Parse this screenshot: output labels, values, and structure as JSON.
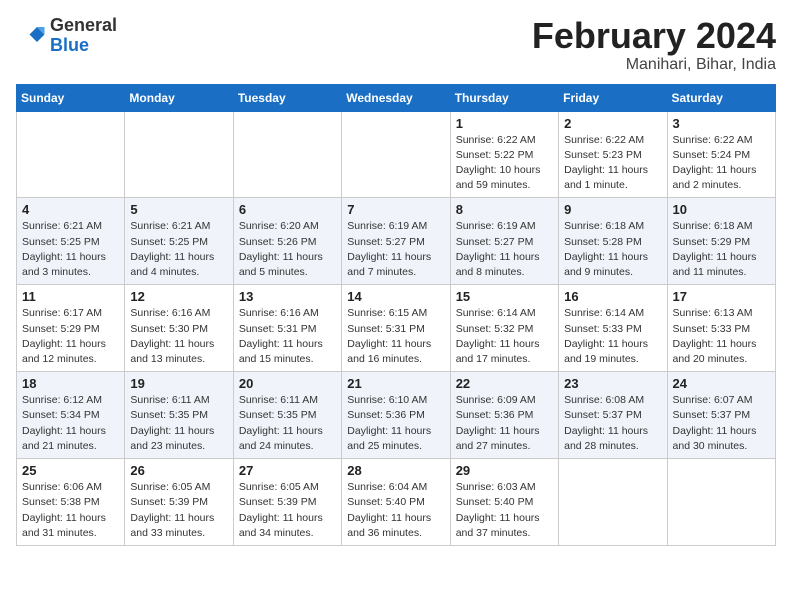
{
  "header": {
    "logo_general": "General",
    "logo_blue": "Blue",
    "month_title": "February 2024",
    "location": "Manihari, Bihar, India"
  },
  "weekdays": [
    "Sunday",
    "Monday",
    "Tuesday",
    "Wednesday",
    "Thursday",
    "Friday",
    "Saturday"
  ],
  "weeks": [
    [
      {
        "day": "",
        "info": ""
      },
      {
        "day": "",
        "info": ""
      },
      {
        "day": "",
        "info": ""
      },
      {
        "day": "",
        "info": ""
      },
      {
        "day": "1",
        "sunrise": "Sunrise: 6:22 AM",
        "sunset": "Sunset: 5:22 PM",
        "daylight": "Daylight: 10 hours and 59 minutes."
      },
      {
        "day": "2",
        "sunrise": "Sunrise: 6:22 AM",
        "sunset": "Sunset: 5:23 PM",
        "daylight": "Daylight: 11 hours and 1 minute."
      },
      {
        "day": "3",
        "sunrise": "Sunrise: 6:22 AM",
        "sunset": "Sunset: 5:24 PM",
        "daylight": "Daylight: 11 hours and 2 minutes."
      }
    ],
    [
      {
        "day": "4",
        "sunrise": "Sunrise: 6:21 AM",
        "sunset": "Sunset: 5:25 PM",
        "daylight": "Daylight: 11 hours and 3 minutes."
      },
      {
        "day": "5",
        "sunrise": "Sunrise: 6:21 AM",
        "sunset": "Sunset: 5:25 PM",
        "daylight": "Daylight: 11 hours and 4 minutes."
      },
      {
        "day": "6",
        "sunrise": "Sunrise: 6:20 AM",
        "sunset": "Sunset: 5:26 PM",
        "daylight": "Daylight: 11 hours and 5 minutes."
      },
      {
        "day": "7",
        "sunrise": "Sunrise: 6:19 AM",
        "sunset": "Sunset: 5:27 PM",
        "daylight": "Daylight: 11 hours and 7 minutes."
      },
      {
        "day": "8",
        "sunrise": "Sunrise: 6:19 AM",
        "sunset": "Sunset: 5:27 PM",
        "daylight": "Daylight: 11 hours and 8 minutes."
      },
      {
        "day": "9",
        "sunrise": "Sunrise: 6:18 AM",
        "sunset": "Sunset: 5:28 PM",
        "daylight": "Daylight: 11 hours and 9 minutes."
      },
      {
        "day": "10",
        "sunrise": "Sunrise: 6:18 AM",
        "sunset": "Sunset: 5:29 PM",
        "daylight": "Daylight: 11 hours and 11 minutes."
      }
    ],
    [
      {
        "day": "11",
        "sunrise": "Sunrise: 6:17 AM",
        "sunset": "Sunset: 5:29 PM",
        "daylight": "Daylight: 11 hours and 12 minutes."
      },
      {
        "day": "12",
        "sunrise": "Sunrise: 6:16 AM",
        "sunset": "Sunset: 5:30 PM",
        "daylight": "Daylight: 11 hours and 13 minutes."
      },
      {
        "day": "13",
        "sunrise": "Sunrise: 6:16 AM",
        "sunset": "Sunset: 5:31 PM",
        "daylight": "Daylight: 11 hours and 15 minutes."
      },
      {
        "day": "14",
        "sunrise": "Sunrise: 6:15 AM",
        "sunset": "Sunset: 5:31 PM",
        "daylight": "Daylight: 11 hours and 16 minutes."
      },
      {
        "day": "15",
        "sunrise": "Sunrise: 6:14 AM",
        "sunset": "Sunset: 5:32 PM",
        "daylight": "Daylight: 11 hours and 17 minutes."
      },
      {
        "day": "16",
        "sunrise": "Sunrise: 6:14 AM",
        "sunset": "Sunset: 5:33 PM",
        "daylight": "Daylight: 11 hours and 19 minutes."
      },
      {
        "day": "17",
        "sunrise": "Sunrise: 6:13 AM",
        "sunset": "Sunset: 5:33 PM",
        "daylight": "Daylight: 11 hours and 20 minutes."
      }
    ],
    [
      {
        "day": "18",
        "sunrise": "Sunrise: 6:12 AM",
        "sunset": "Sunset: 5:34 PM",
        "daylight": "Daylight: 11 hours and 21 minutes."
      },
      {
        "day": "19",
        "sunrise": "Sunrise: 6:11 AM",
        "sunset": "Sunset: 5:35 PM",
        "daylight": "Daylight: 11 hours and 23 minutes."
      },
      {
        "day": "20",
        "sunrise": "Sunrise: 6:11 AM",
        "sunset": "Sunset: 5:35 PM",
        "daylight": "Daylight: 11 hours and 24 minutes."
      },
      {
        "day": "21",
        "sunrise": "Sunrise: 6:10 AM",
        "sunset": "Sunset: 5:36 PM",
        "daylight": "Daylight: 11 hours and 25 minutes."
      },
      {
        "day": "22",
        "sunrise": "Sunrise: 6:09 AM",
        "sunset": "Sunset: 5:36 PM",
        "daylight": "Daylight: 11 hours and 27 minutes."
      },
      {
        "day": "23",
        "sunrise": "Sunrise: 6:08 AM",
        "sunset": "Sunset: 5:37 PM",
        "daylight": "Daylight: 11 hours and 28 minutes."
      },
      {
        "day": "24",
        "sunrise": "Sunrise: 6:07 AM",
        "sunset": "Sunset: 5:37 PM",
        "daylight": "Daylight: 11 hours and 30 minutes."
      }
    ],
    [
      {
        "day": "25",
        "sunrise": "Sunrise: 6:06 AM",
        "sunset": "Sunset: 5:38 PM",
        "daylight": "Daylight: 11 hours and 31 minutes."
      },
      {
        "day": "26",
        "sunrise": "Sunrise: 6:05 AM",
        "sunset": "Sunset: 5:39 PM",
        "daylight": "Daylight: 11 hours and 33 minutes."
      },
      {
        "day": "27",
        "sunrise": "Sunrise: 6:05 AM",
        "sunset": "Sunset: 5:39 PM",
        "daylight": "Daylight: 11 hours and 34 minutes."
      },
      {
        "day": "28",
        "sunrise": "Sunrise: 6:04 AM",
        "sunset": "Sunset: 5:40 PM",
        "daylight": "Daylight: 11 hours and 36 minutes."
      },
      {
        "day": "29",
        "sunrise": "Sunrise: 6:03 AM",
        "sunset": "Sunset: 5:40 PM",
        "daylight": "Daylight: 11 hours and 37 minutes."
      },
      {
        "day": "",
        "info": ""
      },
      {
        "day": "",
        "info": ""
      }
    ]
  ]
}
